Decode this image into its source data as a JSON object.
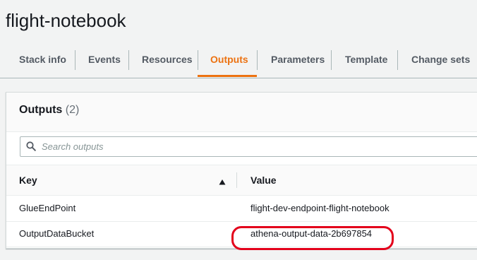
{
  "stack": {
    "name": "flight-notebook"
  },
  "tabs": [
    {
      "label": "Stack info",
      "active": false
    },
    {
      "label": "Events",
      "active": false
    },
    {
      "label": "Resources",
      "active": false
    },
    {
      "label": "Outputs",
      "active": true
    },
    {
      "label": "Parameters",
      "active": false
    },
    {
      "label": "Template",
      "active": false
    },
    {
      "label": "Change sets",
      "active": false
    }
  ],
  "outputs": {
    "title": "Outputs",
    "count": "(2)",
    "search": {
      "placeholder": "Search outputs",
      "value": ""
    },
    "columns": {
      "key": "Key",
      "value": "Value"
    },
    "sort": {
      "column": "Key",
      "direction": "ascending",
      "icon": "sort-up-triangle-icon"
    },
    "rows": [
      {
        "key": "GlueEndPoint",
        "value": "flight-dev-endpoint-flight-notebook"
      },
      {
        "key": "OutputDataBucket",
        "value": "athena-output-data-2b697854",
        "highlighted": true
      }
    ]
  },
  "colors": {
    "accent": "#ec7211",
    "annotation": "#e3001b",
    "text": "#16191f",
    "muted": "#545b64"
  }
}
